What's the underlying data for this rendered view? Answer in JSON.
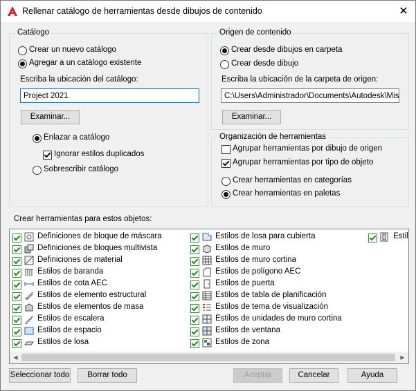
{
  "window": {
    "title": "Rellenar catálogo de herramientas desde dibujos de contenido",
    "close_glyph": "✕",
    "app_icon": "autocad-a-icon",
    "accent_red": "#d6202d"
  },
  "catalog": {
    "group_label": "Catálogo",
    "radio_new": {
      "label": "Crear un nuevo catálogo",
      "selected": false
    },
    "radio_add": {
      "label": "Agregar a un catálogo existente",
      "selected": true
    },
    "location_label": "Escriba la ubicación del catálogo:",
    "location_value": "Project 2021",
    "browse_label": "Examinar...",
    "link_radio": {
      "label": "Enlazar a catálogo",
      "selected": true
    },
    "ignore_check": {
      "label": "Ignorar estilos duplicados",
      "checked": true
    },
    "overwrite_radio": {
      "label": "Sobrescribir catálogo",
      "selected": false
    }
  },
  "source": {
    "group_label": "Origen de contenido",
    "radio_folder": {
      "label": "Crear desde dibujos en carpeta",
      "selected": true
    },
    "radio_drawing": {
      "label": "Crear desde dibujo",
      "selected": false
    },
    "location_label": "Escriba la ubicación de la carpeta de origen:",
    "location_value": "C:\\Users\\Administrador\\Documents\\Autodesk\\Mis pr",
    "browse_label": "Examinar..."
  },
  "organization": {
    "group_label": "Organización de herramientas",
    "group_by_drawing": {
      "label": "Agrupar herramientas por dibujo de origen",
      "checked": false
    },
    "group_by_type": {
      "label": "Agrupar herramientas por tipo de objeto",
      "checked": true
    },
    "create_categories": {
      "label": "Crear herramientas en categorías",
      "selected": false
    },
    "create_palettes": {
      "label": "Crear herramientas en paletas",
      "selected": true
    }
  },
  "objects": {
    "label": "Crear herramientas para estos objetos:",
    "check_color": "#1e8a1e",
    "col1": [
      {
        "label": "Definiciones de bloque de máscara",
        "icon": "mask-block-icon",
        "checked": true
      },
      {
        "label": "Definiciones de bloques multivista",
        "icon": "multiview-block-icon",
        "checked": true
      },
      {
        "label": "Definiciones de material",
        "icon": "material-icon",
        "checked": true
      },
      {
        "label": "Estilos de baranda",
        "icon": "railing-icon",
        "checked": true
      },
      {
        "label": "Estilos de cota AEC",
        "icon": "aec-dimension-icon",
        "checked": true
      },
      {
        "label": "Estilos de elemento estructural",
        "icon": "structural-member-icon",
        "checked": true
      },
      {
        "label": "Estilos de elementos de masa",
        "icon": "mass-element-icon",
        "checked": true
      },
      {
        "label": "Estilos de escalera",
        "icon": "stair-icon",
        "checked": true
      },
      {
        "label": "Estilos de espacio",
        "icon": "space-icon",
        "checked": true
      },
      {
        "label": "Estilos de losa",
        "icon": "slab-icon",
        "checked": true
      }
    ],
    "col2": [
      {
        "label": "Estilos de losa para cubierta",
        "icon": "roof-slab-icon",
        "checked": true
      },
      {
        "label": "Estilos de muro",
        "icon": "wall-icon",
        "checked": true
      },
      {
        "label": "Estilos de muro cortina",
        "icon": "curtain-wall-icon",
        "checked": true
      },
      {
        "label": "Estilos de polígono AEC",
        "icon": "aec-polygon-icon",
        "checked": true
      },
      {
        "label": "Estilos de puerta",
        "icon": "door-icon",
        "checked": true
      },
      {
        "label": "Estilos de tabla de planificación",
        "icon": "schedule-table-icon",
        "checked": true
      },
      {
        "label": "Estilos de tema de visualización",
        "icon": "display-theme-icon",
        "checked": true
      },
      {
        "label": "Estilos de unidades de muro cortina",
        "icon": "curtain-wall-unit-icon",
        "checked": true
      },
      {
        "label": "Estilos de ventana",
        "icon": "window-icon",
        "checked": true
      },
      {
        "label": "Estilos de zona",
        "icon": "zone-icon",
        "checked": true
      }
    ],
    "col3": [
      {
        "label": "Estilo",
        "icon": "window-assembly-icon",
        "checked": true
      }
    ]
  },
  "buttons": {
    "select_all": "Seleccionar todo",
    "clear_all": "Borrar todo",
    "accept": "Aceptar",
    "cancel": "Cancelar",
    "help": "Ayuda"
  }
}
